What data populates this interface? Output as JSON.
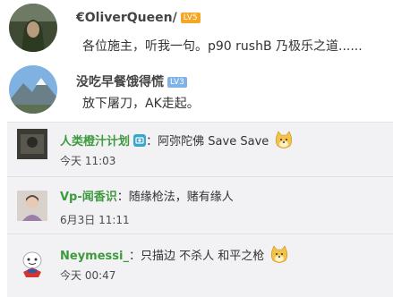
{
  "posts": [
    {
      "username": "€OliverQueen/",
      "badge": "LV5",
      "text": "各位施主，听我一句。p90 rushB 乃极乐之道......"
    },
    {
      "username": "没吃早餐饿得慌",
      "badge": "LV3",
      "text": "放下屠刀，AK走起。"
    }
  ],
  "replies": [
    {
      "username": "人类橙汁计划",
      "separator": "：",
      "text": "阿弥陀佛 Save Save",
      "time": "今天 11:03"
    },
    {
      "username": "Vp-闻香识",
      "separator": "：",
      "text": "随缘枪法，赌有缘人",
      "time": "6月3日 11:11"
    },
    {
      "username": "Neymessi_",
      "separator": "：",
      "text": "只描边 不杀人 和平之枪",
      "time": "今天 00:47"
    }
  ],
  "colors": {
    "username_green": "#3d9a3d",
    "comment_bg": "#f2f2f5",
    "badge_orange": "#f5a623",
    "badge_blue": "#7fb3e6"
  },
  "icons": {
    "post1_avatar": "green-hooded-archer-avatar",
    "post2_avatar": "mountain-landscape-avatar",
    "reply1_avatar": "dark-photo-avatar",
    "reply2_avatar": "person-photo-avatar",
    "reply3_avatar": "cartoon-avatar",
    "member_icon": "camera-member-icon",
    "emoji": "doge-emoji"
  }
}
